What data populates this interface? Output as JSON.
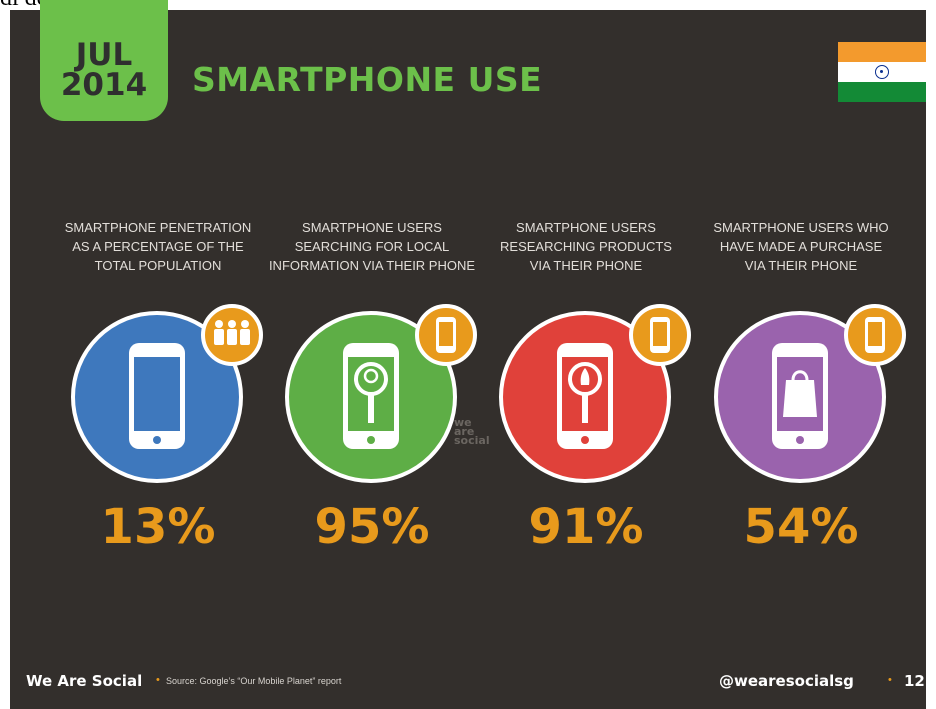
{
  "page_caption": "di động:",
  "header": {
    "date_month": "JUL",
    "date_year": "2014",
    "title": "SMARTPHONE USE",
    "flag_icon": "india-flag-icon"
  },
  "colors": {
    "background": "#332f2c",
    "accent_green": "#6cc04a",
    "accent_orange": "#e89a1c",
    "flag_saffron": "#f39a2d",
    "flag_white": "#ffffff",
    "flag_green": "#138a36",
    "flag_chakra": "#0a2f8f"
  },
  "stats": [
    {
      "label_lines": [
        "SMARTPHONE PENETRATION",
        "AS A PERCENTAGE OF THE",
        "TOTAL POPULATION"
      ],
      "value": "13%",
      "circle_color": "#3e78bd",
      "phone_icon": "smartphone-icon",
      "badge_icon": "people-icon"
    },
    {
      "label_lines": [
        "SMARTPHONE USERS",
        "SEARCHING FOR LOCAL",
        "INFORMATION VIA THEIR PHONE"
      ],
      "value": "95%",
      "circle_color": "#5eae46",
      "phone_icon": "location-search-icon",
      "badge_icon": "smartphone-icon"
    },
    {
      "label_lines": [
        "SMARTPHONE USERS",
        "RESEARCHING PRODUCTS",
        "VIA THEIR PHONE"
      ],
      "value": "91%",
      "circle_color": "#e0413a",
      "phone_icon": "product-search-icon",
      "badge_icon": "smartphone-icon"
    },
    {
      "label_lines": [
        "SMARTPHONE USERS WHO",
        "HAVE MADE A PURCHASE",
        "VIA THEIR PHONE"
      ],
      "value": "54%",
      "circle_color": "#9a63ad",
      "phone_icon": "shopping-bag-icon",
      "badge_icon": "smartphone-icon"
    }
  ],
  "watermark_lines": [
    "we",
    "are",
    "social"
  ],
  "footer": {
    "brand": "We Are Social",
    "separator": "•",
    "source": "Source: Google’s “Our Mobile Planet” report",
    "handle": "@wearesocialsg",
    "page_number": "12"
  }
}
